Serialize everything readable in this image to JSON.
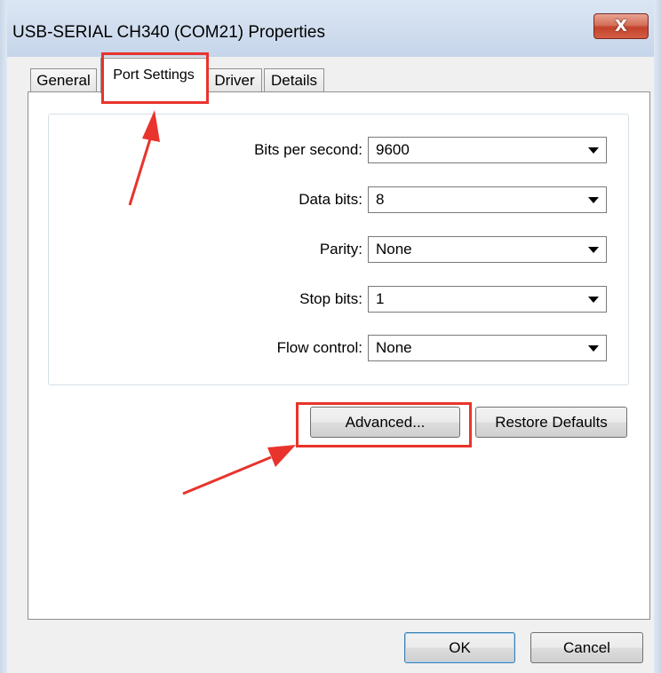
{
  "window": {
    "title": "USB-SERIAL CH340 (COM21) Properties",
    "close_glyph": "X"
  },
  "tabs": [
    {
      "label": "General",
      "active": false
    },
    {
      "label": "Port Settings",
      "active": true
    },
    {
      "label": "Driver",
      "active": false
    },
    {
      "label": "Details",
      "active": false
    }
  ],
  "settings": [
    {
      "label": "Bits per second:",
      "value": "9600"
    },
    {
      "label": "Data bits:",
      "value": "8"
    },
    {
      "label": "Parity:",
      "value": "None"
    },
    {
      "label": "Stop bits:",
      "value": "1"
    },
    {
      "label": "Flow control:",
      "value": "None"
    }
  ],
  "buttons": {
    "advanced": "Advanced...",
    "restore_defaults": "Restore Defaults",
    "ok": "OK",
    "cancel": "Cancel"
  },
  "annotations": {
    "highlight_color": "#e8342c",
    "arrow_color": "#e8342c"
  }
}
